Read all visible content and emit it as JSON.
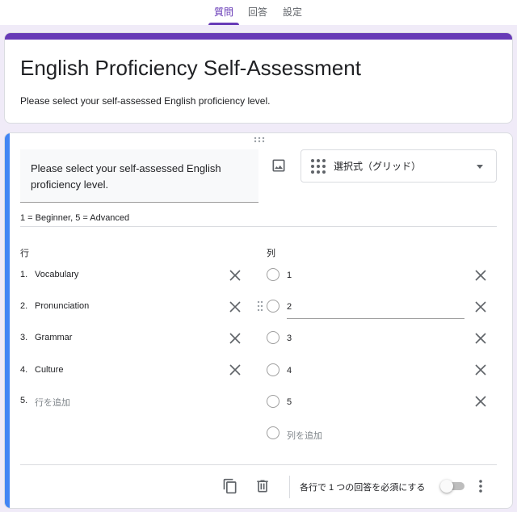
{
  "tabs": [
    {
      "label": "質問",
      "active": true
    },
    {
      "label": "回答",
      "active": false
    },
    {
      "label": "設定",
      "active": false
    }
  ],
  "accent_color": "#673ab7",
  "active_card_color": "#4285f4",
  "form": {
    "title": "English Proficiency Self-Assessment",
    "description": "Please select your self-assessed English proficiency level."
  },
  "question": {
    "text": "Please select your self-assessed English proficiency level.",
    "type_label": "選択式（グリッド）",
    "type_icon": "grid-dots-icon",
    "description": "1 = Beginner, 5 = Advanced",
    "rows_header": "行",
    "columns_header": "列",
    "rows": [
      {
        "num": "1.",
        "label": "Vocabulary"
      },
      {
        "num": "2.",
        "label": "Pronunciation"
      },
      {
        "num": "3.",
        "label": "Grammar"
      },
      {
        "num": "4.",
        "label": "Culture"
      }
    ],
    "add_row": {
      "num": "5.",
      "label": "行を追加"
    },
    "columns": [
      {
        "label": "1"
      },
      {
        "label": "2"
      },
      {
        "label": "3"
      },
      {
        "label": "4"
      },
      {
        "label": "5"
      }
    ],
    "add_column": "列を追加",
    "require_one_per_row_label": "各行で 1 つの回答を必須にする",
    "require_one_per_row": false
  }
}
